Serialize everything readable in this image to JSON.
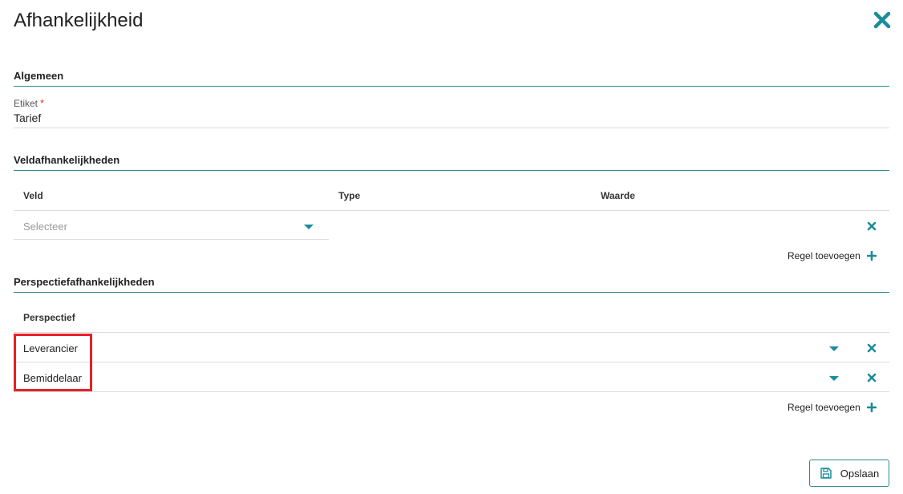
{
  "dialog": {
    "title": "Afhankelijkheid"
  },
  "algemeen": {
    "section_title": "Algemeen",
    "label_field_label": "Etiket",
    "required_marker": "*",
    "label_value": "Tarief"
  },
  "veld": {
    "section_title": "Veldafhankelijkheden",
    "columns": [
      "Veld",
      "Type",
      "Waarde"
    ],
    "rows": [
      {
        "placeholder": "Selecteer"
      }
    ],
    "add_rule_label": "Regel toevoegen"
  },
  "perspectief": {
    "section_title": "Perspectiefafhankelijkheden",
    "column": "Perspectief",
    "rows": [
      {
        "value": "Leverancier"
      },
      {
        "value": "Bemiddelaar"
      }
    ],
    "add_rule_label": "Regel toevoegen"
  },
  "footer": {
    "save_label": "Opslaan"
  },
  "colors": {
    "accent": "#1a8d99",
    "section_line": "#2b8a8f",
    "required": "#e0342b",
    "highlight": "#e52228"
  }
}
